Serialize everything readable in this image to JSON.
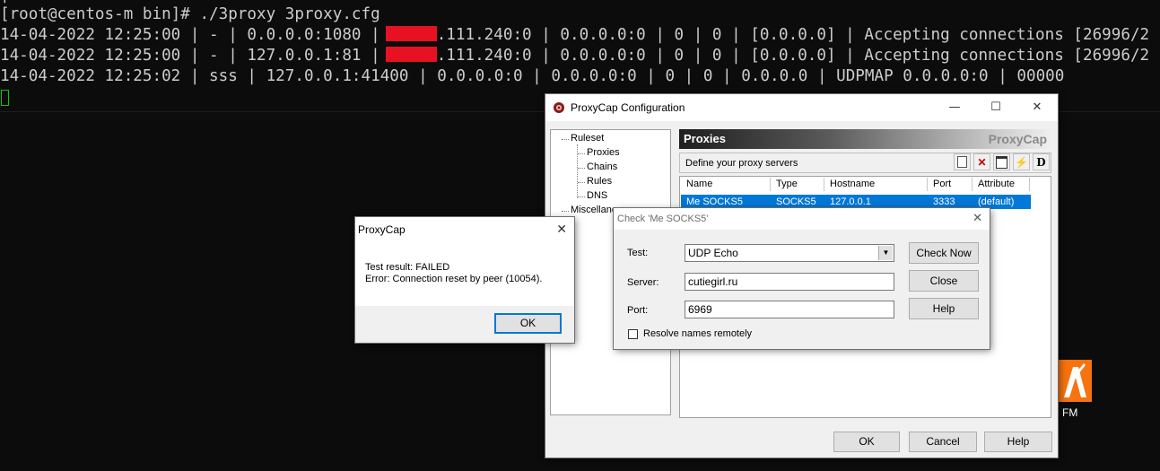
{
  "terminal": {
    "prompt": "[root@centos-m bin]# ./3proxy 3proxy.cfg",
    "line1_pre": "14-04-2022 12:25:00 | - | 0.0.0.0:1080 |",
    "line1_post": ".111.240:0 | 0.0.0.0:0 | 0 | 0 | [0.0.0.0] | Accepting connections [26996/2",
    "line2_pre": "14-04-2022 12:25:00 | - | 127.0.0.1:81 |",
    "line2_post": ".111.240:0 | 0.0.0.0:0 | 0 | 0 | [0.0.0.0] | Accepting connections [26996/2",
    "line3": "14-04-2022 12:25:02 | sss | 127.0.0.1:41400 | 0.0.0.0:0 | 0.0.0.0:0 | 0 | 0 | 0.0.0.0 | UDPMAP 0.0.0.0:0 | 00000"
  },
  "config_window": {
    "title": "ProxyCap Configuration",
    "tree": {
      "ruleset": "Ruleset",
      "proxies": "Proxies",
      "chains": "Chains",
      "rules": "Rules",
      "dns": "DNS",
      "misc": "Miscellane"
    },
    "banner_title": "Proxies",
    "banner_brand": "ProxyCap",
    "description": "Define your proxy servers",
    "columns": [
      "Name",
      "Type",
      "Hostname",
      "Port",
      "Attribute"
    ],
    "row": {
      "name": "Me SOCKS5",
      "type": "SOCKS5",
      "hostname": "127.0.0.1",
      "port": "3333",
      "attribute": "(default)"
    },
    "ok": "OK",
    "cancel": "Cancel",
    "help": "Help",
    "d_tool": "D"
  },
  "check_dialog": {
    "title": "Check 'Me SOCKS5'",
    "test_label": "Test:",
    "test_value": "UDP Echo",
    "server_label": "Server:",
    "server_value": "cutiegirl.ru",
    "port_label": "Port:",
    "port_value": "6969",
    "resolve_label": "Resolve names remotely",
    "check_now": "Check Now",
    "close": "Close",
    "help": "Help"
  },
  "message_box": {
    "title": "ProxyCap",
    "line1": "Test result: FAILED",
    "line2": "Error: Connection reset by peer (10054).",
    "ok": "OK"
  },
  "desktop_icon": {
    "label": "FM"
  },
  "colors": {
    "selection": "#0078d7",
    "redaction": "#e81123",
    "desktop_icon": "#f7730e"
  }
}
